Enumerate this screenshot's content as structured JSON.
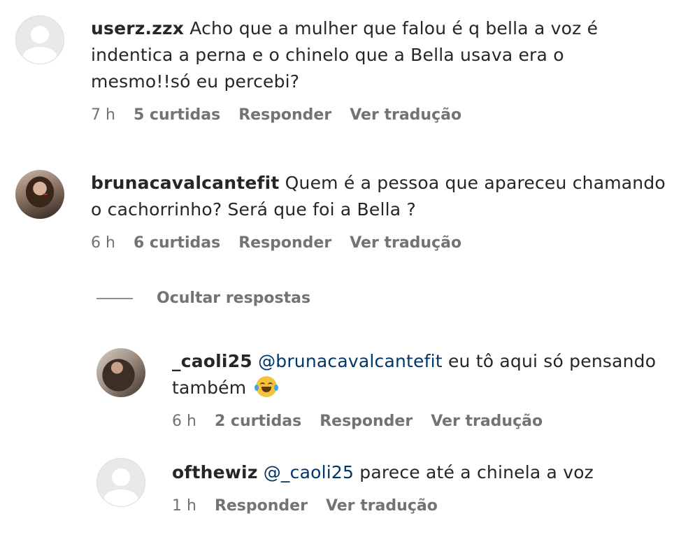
{
  "comments": [
    {
      "username": "userz.zzx",
      "text": "Acho que a mulher que falou é q bella a voz é indentica a perna e o chinelo que a Bella usava era o mesmo!!só eu percebi?",
      "time": "7 h",
      "likes": "5 curtidas",
      "reply": "Responder",
      "translate": "Ver tradução"
    },
    {
      "username": "brunacavalcantefit",
      "text": "Quem é a pessoa que apareceu chamando o cachorrinho? Será que foi a Bella ?",
      "time": "6 h",
      "likes": "6 curtidas",
      "reply": "Responder",
      "translate": "Ver tradução"
    }
  ],
  "hide_replies": "Ocultar respostas",
  "replies": [
    {
      "username": "_caoli25",
      "mention": "@brunacavalcantefit",
      "text": "eu tô aqui só pensando também",
      "emoji": "laughing-tears-emoji",
      "time": "6 h",
      "likes": "2 curtidas",
      "reply": "Responder",
      "translate": "Ver tradução"
    },
    {
      "username": "ofthewiz",
      "mention": "@_caoli25",
      "text": "parece até a chinela a voz",
      "time": "1 h",
      "reply": "Responder",
      "translate": "Ver tradução"
    }
  ],
  "colors": {
    "text": "#262626",
    "secondary": "#737373",
    "mention": "#00376b"
  }
}
